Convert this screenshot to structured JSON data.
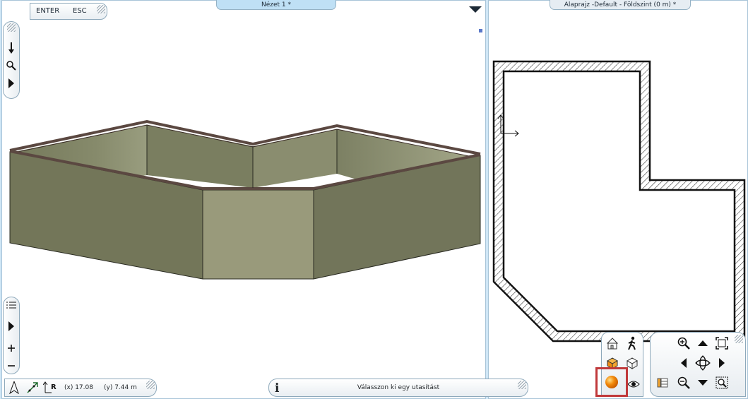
{
  "toolbar_top": {
    "enter_label": "ENTER",
    "esc_label": "ESC"
  },
  "views": {
    "left_tab_title": "Nézet 1 *",
    "right_tab_title": "Alaprajz -Default - Földszint (0 m) *"
  },
  "status": {
    "x_coord": "(x) 17.08",
    "y_coord": "(y) 7.44 m",
    "message": "Válasszon ki egy utasítást"
  },
  "colors": {
    "panel_bg": "#ffffff",
    "chrome_bg": "#cfe6f6",
    "active_tab": "#bfe0f5",
    "wall_face_dark": "#737659",
    "wall_face_light": "#999a7b",
    "wall_top": "#5b4841",
    "highlight": "#c0393b",
    "render_orange": "#f28a0c"
  },
  "icons": {
    "left_top_toolbar": [
      "step-arrow-icon",
      "zoom-icon",
      "play-icon"
    ],
    "left_bottom_toolbar": [
      "list-icon",
      "play-icon",
      "plus-icon",
      "minus-icon"
    ],
    "status_left": [
      "north-arrow-icon",
      "snap-icon",
      "reference-icon"
    ],
    "view_tools": [
      "house-icon",
      "walk-icon",
      "box-orange-icon",
      "box-outline-icon",
      "render-icon",
      "eye-icon"
    ],
    "nav_tools": [
      "zoom-in-icon",
      "pan-up-icon",
      "fit-icon",
      "pan-left-icon",
      "orbit-icon",
      "pan-right-icon",
      "layers-icon",
      "zoom-out-icon",
      "pan-down-icon",
      "zoom-window-icon"
    ]
  }
}
